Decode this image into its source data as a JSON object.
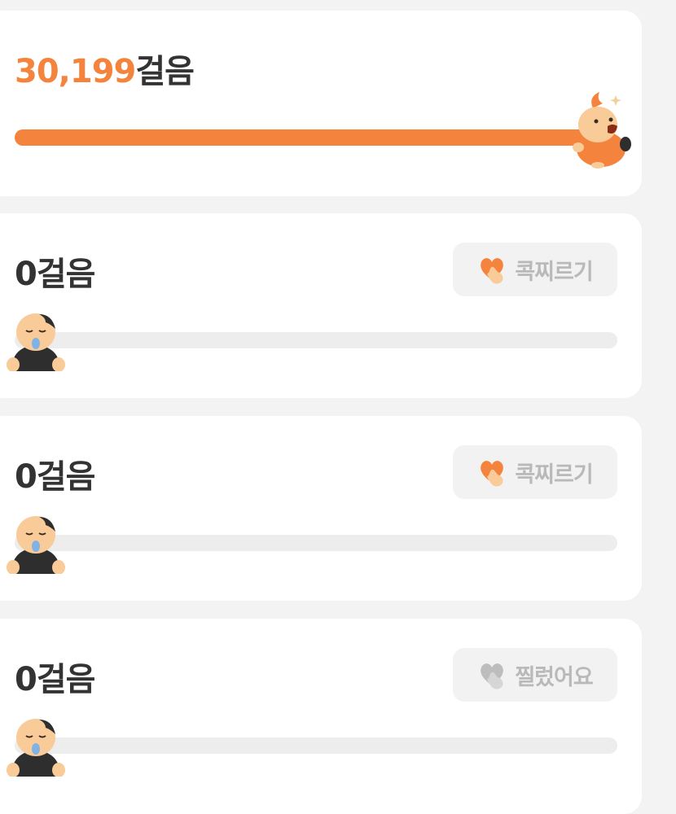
{
  "rows": [
    {
      "steps_number": "30,199",
      "steps_suffix": "걸음",
      "progress": 1.0,
      "mascot": "happy-orange-mascot-icon",
      "button": null
    },
    {
      "steps_number": "",
      "steps_suffix": "0걸음",
      "progress": 0.0,
      "mascot": "sleeping-mascot-icon",
      "button": {
        "label": "콕찌르기",
        "icon": "poke-heart-hand-icon",
        "state": "active"
      }
    },
    {
      "steps_number": "",
      "steps_suffix": "0걸음",
      "progress": 0.0,
      "mascot": "sleeping-mascot-icon",
      "button": {
        "label": "콕찌르기",
        "icon": "poke-heart-hand-icon",
        "state": "active"
      }
    },
    {
      "steps_number": "",
      "steps_suffix": "0걸음",
      "progress": 0.0,
      "mascot": "sleeping-mascot-icon",
      "button": {
        "label": "찔렀어요",
        "icon": "poke-heart-hand-icon",
        "state": "done"
      }
    }
  ],
  "colors": {
    "accent": "#f4843d",
    "track": "#ededed",
    "text": "#333333",
    "button_bg": "#f2f2f2",
    "button_text": "#b9b9b9",
    "heart_active": "#f4843d",
    "heart_done": "#bdbdbd",
    "background": "#f3f3f3"
  }
}
